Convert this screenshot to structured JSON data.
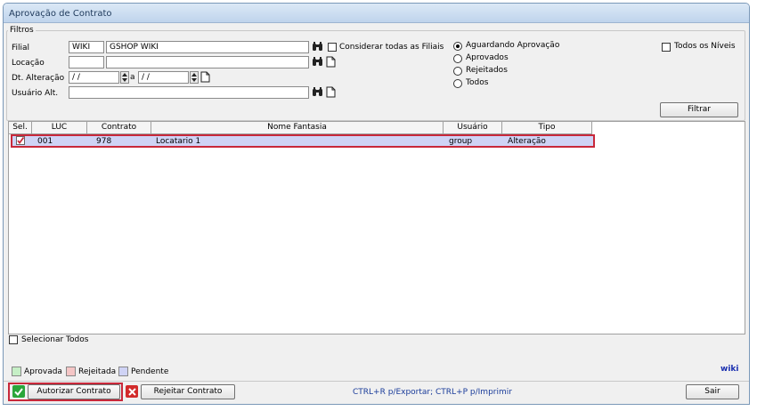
{
  "window": {
    "title": "Aprovação de Contrato"
  },
  "filters": {
    "group_label": "Filtros",
    "filial_label": "Filial",
    "filial_code": "WIKI",
    "filial_name": "GSHOP WIKI",
    "locacao_label": "Locação",
    "locacao_code": "",
    "locacao_name": "",
    "dt_label": "Dt. Alteração",
    "dt_from": "/ /",
    "dt_sep": "a",
    "dt_to": "/ /",
    "usuario_label": "Usuário Alt.",
    "usuario_value": "",
    "consider_all_label": "Considerar todas as Filiais",
    "all_levels_label": "Todos os Níveis",
    "status_options": [
      {
        "label": "Aguardando Aprovação",
        "selected": true
      },
      {
        "label": "Aprovados",
        "selected": false
      },
      {
        "label": "Rejeitados",
        "selected": false
      },
      {
        "label": "Todos",
        "selected": false
      }
    ],
    "filter_button": "Filtrar"
  },
  "grid": {
    "columns": [
      "Sel.",
      "LUC",
      "Contrato",
      "Nome Fantasia",
      "Usuário",
      "Tipo"
    ],
    "rows": [
      {
        "sel": true,
        "luc": "001",
        "contrato": "978",
        "nome": "Locatario 1",
        "usuario": "group",
        "tipo": "Alteração"
      }
    ]
  },
  "select_all_label": "Selecionar Todos",
  "legend": [
    {
      "label": "Aprovada",
      "color": "#c6efc6"
    },
    {
      "label": "Rejeitada",
      "color": "#f5c6c6"
    },
    {
      "label": "Pendente",
      "color": "#cfd3f5"
    }
  ],
  "brand": "wiki",
  "footer": {
    "authorize_button": "Autorizar Contrato",
    "reject_button": "Rejeitar Contrato",
    "hint": "CTRL+R p/Exportar; CTRL+P p/Imprimir",
    "exit_button": "Sair"
  },
  "colors": {
    "highlight": "#c8283a",
    "hint_text": "#1a3c9a",
    "brand": "#1a2fb0"
  }
}
